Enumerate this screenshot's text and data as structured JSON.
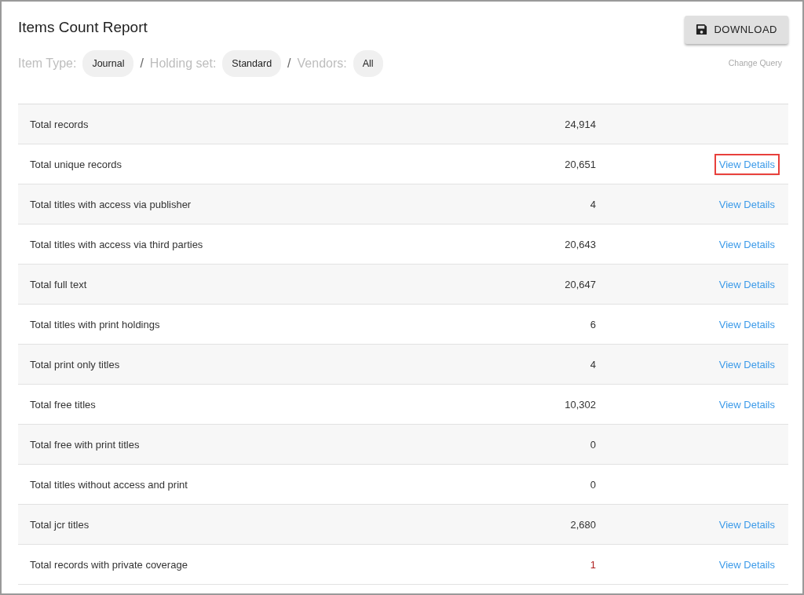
{
  "title": "Items Count Report",
  "download_button": {
    "label": "DOWNLOAD"
  },
  "query": {
    "filters": [
      {
        "label": "Item Type:",
        "value": "Journal"
      },
      {
        "label": "Holding set:",
        "value": "Standard"
      },
      {
        "label": "Vendors:",
        "value": "All"
      }
    ],
    "separator": "/",
    "change_link": "Change Query"
  },
  "rows": [
    {
      "label": "Total records",
      "count": "24,914",
      "alert": false
    },
    {
      "label": "Total unique records",
      "count": "20,651",
      "alert": false,
      "link": "View Details",
      "highlighted": true
    },
    {
      "label": "Total titles with access via publisher",
      "count": "4",
      "alert": false,
      "link": "View Details",
      "highlighted": false
    },
    {
      "label": "Total titles with access via third parties",
      "count": "20,643",
      "alert": false,
      "link": "View Details",
      "highlighted": false
    },
    {
      "label": "Total full text",
      "count": "20,647",
      "alert": false,
      "link": "View Details",
      "highlighted": false
    },
    {
      "label": "Total titles with print holdings",
      "count": "6",
      "alert": false,
      "link": "View Details",
      "highlighted": false
    },
    {
      "label": "Total print only titles",
      "count": "4",
      "alert": false,
      "link": "View Details",
      "highlighted": false
    },
    {
      "label": "Total free titles",
      "count": "10,302",
      "alert": false,
      "link": "View Details",
      "highlighted": false
    },
    {
      "label": "Total free with print titles",
      "count": "0",
      "alert": false
    },
    {
      "label": "Total titles without access and print",
      "count": "0",
      "alert": false
    },
    {
      "label": "Total jcr titles",
      "count": "2,680",
      "alert": false,
      "link": "View Details",
      "highlighted": false
    },
    {
      "label": "Total records with private coverage",
      "count": "1",
      "alert": true,
      "link": "View Details",
      "highlighted": false
    }
  ]
}
